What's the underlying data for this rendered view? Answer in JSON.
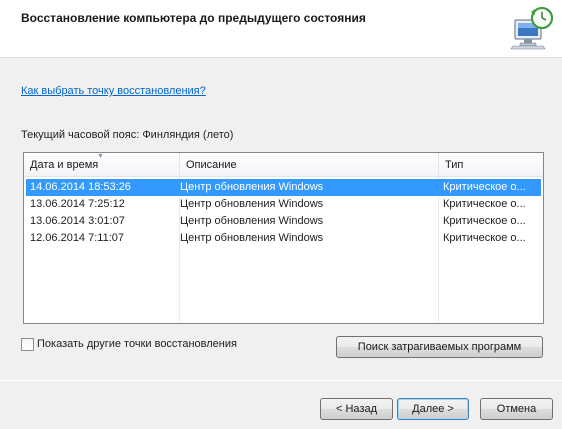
{
  "header": {
    "title": "Восстановление компьютера до предыдущего состояния",
    "icon": "system-restore-icon"
  },
  "help_link": "Как выбрать точку восстановления?",
  "timezone_text": "Текущий часовой пояс: Финляндия (лето)",
  "table": {
    "columns": [
      "Дата и время",
      "Описание",
      "Тип"
    ],
    "sorted_column": "Дата и время",
    "rows": [
      {
        "datetime": "14.06.2014 18:53:26",
        "description": "Центр обновления Windows",
        "type": "Критическое о...",
        "selected": true
      },
      {
        "datetime": "13.06.2014 7:25:12",
        "description": "Центр обновления Windows",
        "type": "Критическое о...",
        "selected": false
      },
      {
        "datetime": "13.06.2014 3:01:07",
        "description": "Центр обновления Windows",
        "type": "Критическое о...",
        "selected": false
      },
      {
        "datetime": "12.06.2014 7:11:07",
        "description": "Центр обновления Windows",
        "type": "Критическое о...",
        "selected": false
      }
    ]
  },
  "show_more": {
    "label": "Показать другие точки восстановления",
    "checked": false
  },
  "buttons": {
    "scan": "Поиск затрагиваемых программ",
    "back": "< Назад",
    "next": "Далее >",
    "cancel": "Отмена"
  },
  "colors": {
    "selection": "#3399ff",
    "link": "#0066cc",
    "background": "#f0f0f0"
  }
}
